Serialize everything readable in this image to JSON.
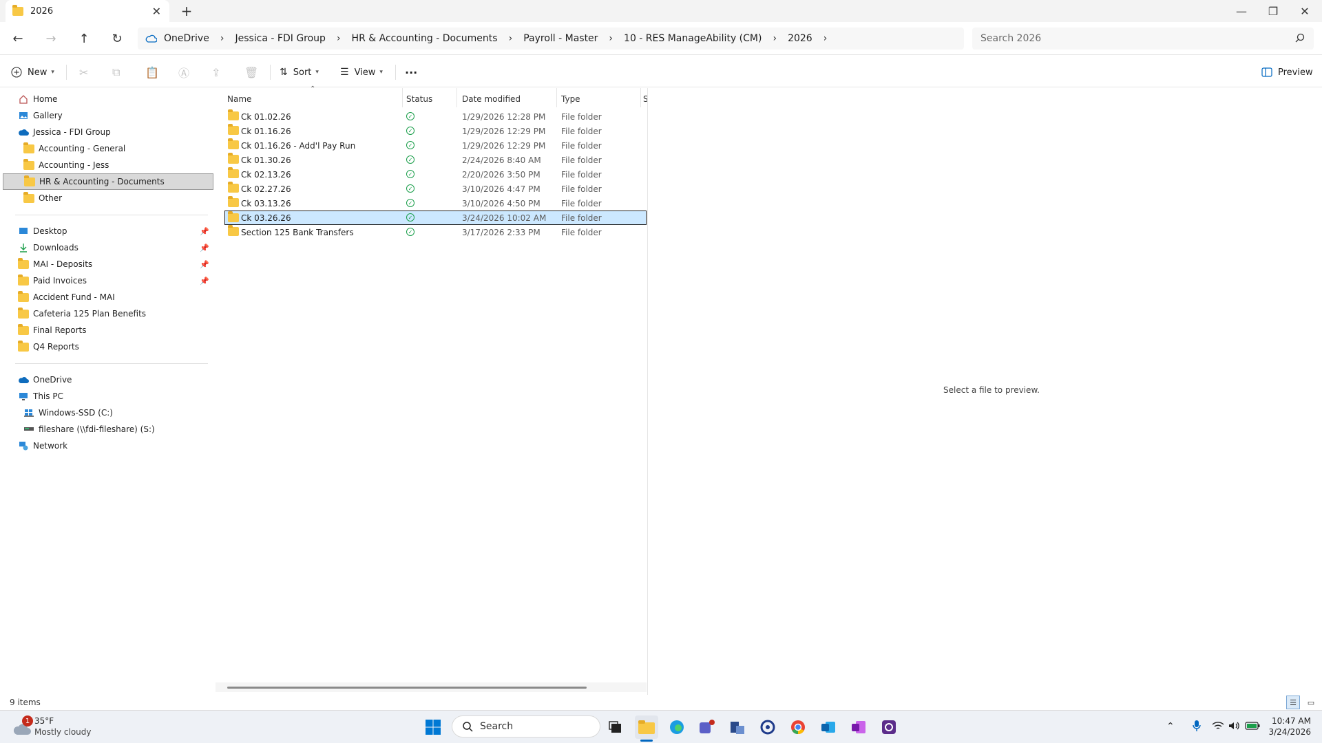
{
  "window": {
    "tab_title": "2026",
    "close_tab": "✕",
    "new_tab": "+",
    "minimize": "—",
    "restore": "❐",
    "close": "✕"
  },
  "nav": {
    "back": "←",
    "forward": "→",
    "up": "↑",
    "refresh": "↻"
  },
  "breadcrumb": [
    "OneDrive",
    "Jessica - FDI Group",
    "HR & Accounting - Documents",
    "Payroll - Master",
    "10 - RES ManageAbility (CM)",
    "2026"
  ],
  "search": {
    "placeholder": "Search 2026"
  },
  "toolbar": {
    "new_label": "New",
    "sort_label": "Sort",
    "view_label": "View",
    "more_label": "···",
    "preview_label": "Preview"
  },
  "sidebar": {
    "section1": [
      {
        "label": "Home",
        "icon": "home-icon"
      },
      {
        "label": "Gallery",
        "icon": "gallery-icon"
      },
      {
        "label": "Jessica - FDI Group",
        "icon": "onedrive-icon"
      },
      {
        "label": "Accounting - General",
        "icon": "folder-icon"
      },
      {
        "label": "Accounting - Jess",
        "icon": "folder-icon"
      },
      {
        "label": "HR & Accounting - Documents",
        "icon": "folder-icon",
        "selected": true
      },
      {
        "label": "Other",
        "icon": "folder-icon"
      }
    ],
    "section2": [
      {
        "label": "Desktop",
        "icon": "desktop-icon",
        "pinned": true
      },
      {
        "label": "Downloads",
        "icon": "download-icon",
        "pinned": true
      },
      {
        "label": "MAI - Deposits",
        "icon": "folder-icon",
        "pinned": true
      },
      {
        "label": "Paid Invoices",
        "icon": "folder-icon",
        "pinned": true
      },
      {
        "label": "Accident Fund - MAI",
        "icon": "folder-icon"
      },
      {
        "label": "Cafeteria 125 Plan Benefits",
        "icon": "folder-icon"
      },
      {
        "label": "Final Reports",
        "icon": "folder-icon"
      },
      {
        "label": "Q4 Reports",
        "icon": "folder-icon"
      }
    ],
    "section3": [
      {
        "label": "OneDrive",
        "icon": "onedrive-icon"
      },
      {
        "label": "This PC",
        "icon": "pc-icon"
      },
      {
        "label": "Windows-SSD (C:)",
        "icon": "drive-icon"
      },
      {
        "label": "fileshare (\\\\fdi-fileshare) (S:)",
        "icon": "network-drive-icon"
      },
      {
        "label": "Network",
        "icon": "network-icon"
      }
    ]
  },
  "columns": {
    "name": "Name",
    "status": "Status",
    "date": "Date modified",
    "type": "Type",
    "size": "S"
  },
  "files": [
    {
      "name": "Ck 01.02.26",
      "date": "1/29/2026 12:28 PM",
      "type": "File folder"
    },
    {
      "name": "Ck 01.16.26",
      "date": "1/29/2026 12:29 PM",
      "type": "File folder"
    },
    {
      "name": "Ck 01.16.26 - Add'l Pay Run",
      "date": "1/29/2026 12:29 PM",
      "type": "File folder"
    },
    {
      "name": "Ck 01.30.26",
      "date": "2/24/2026 8:40 AM",
      "type": "File folder"
    },
    {
      "name": "Ck 02.13.26",
      "date": "2/20/2026 3:50 PM",
      "type": "File folder"
    },
    {
      "name": "Ck 02.27.26",
      "date": "3/10/2026 4:47 PM",
      "type": "File folder"
    },
    {
      "name": "Ck 03.13.26",
      "date": "3/10/2026 4:50 PM",
      "type": "File folder"
    },
    {
      "name": "Ck 03.26.26",
      "date": "3/24/2026 10:02 AM",
      "type": "File folder",
      "selected": true
    },
    {
      "name": "Section 125 Bank Transfers",
      "date": "3/17/2026 2:33 PM",
      "type": "File folder"
    }
  ],
  "preview": {
    "message": "Select a file to preview."
  },
  "statusbar": {
    "count": "9 items"
  },
  "taskbar": {
    "weather_temp": "35°F",
    "weather_desc": "Mostly cloudy",
    "weather_badge": "1",
    "search_label": "Search",
    "time": "10:47 AM",
    "date": "3/24/2026"
  },
  "colors": {
    "accent": "#0067c0",
    "selection": "#cce8ff",
    "folder": "#f8c845",
    "status_ok": "#1a9e4a"
  }
}
